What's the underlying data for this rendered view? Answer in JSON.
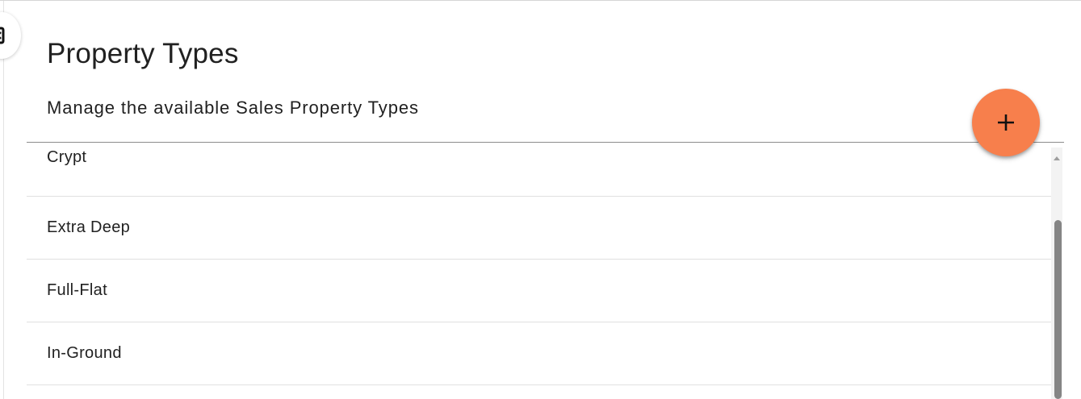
{
  "header": {
    "title": "Property Types",
    "subtitle": "Manage the available Sales Property Types"
  },
  "actions": {
    "add_icon": "plus-icon",
    "collapse_icon": "panel-collapse-icon",
    "accent_color": "#f77f4c"
  },
  "property_types": [
    {
      "label": "Crypt"
    },
    {
      "label": "Extra Deep"
    },
    {
      "label": "Full-Flat"
    },
    {
      "label": "In-Ground"
    }
  ]
}
